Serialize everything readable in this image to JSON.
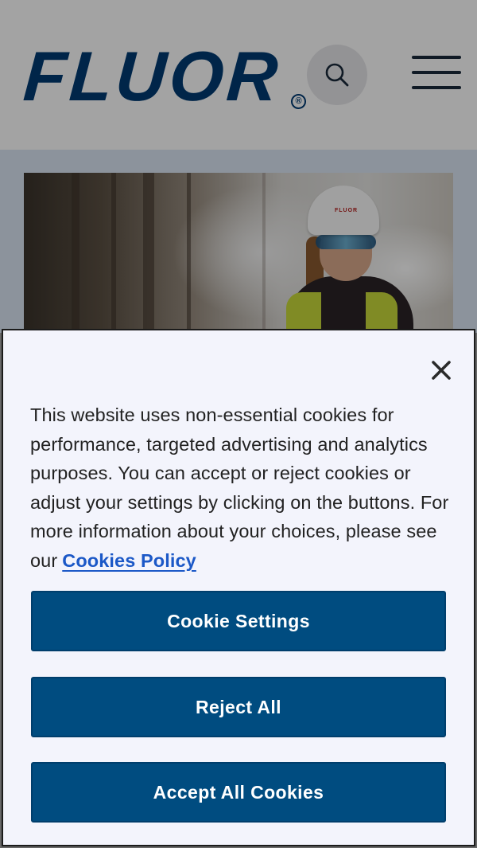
{
  "header": {
    "logo_text": "FLUOR",
    "logo_reg": "®",
    "search_icon": "search-icon",
    "menu_icon": "hamburger-menu-icon"
  },
  "hero": {
    "hat_text": "FLUOR"
  },
  "cookie_banner": {
    "close_icon": "close-icon",
    "message": "This website uses non-essential cookies for performance, targeted advertising and analytics purposes. You can accept or reject cookies or adjust your settings by clicking on the buttons. For more information about your choices, please see our",
    "policy_link": "Cookies Policy",
    "settings_label": "Cookie Settings",
    "reject_label": "Reject All",
    "accept_label": "Accept All Cookies"
  },
  "colors": {
    "brand_blue": "#003b73",
    "button_blue": "#004c80",
    "link_blue": "#1b58c7",
    "dialog_bg": "#f3f4fc"
  }
}
